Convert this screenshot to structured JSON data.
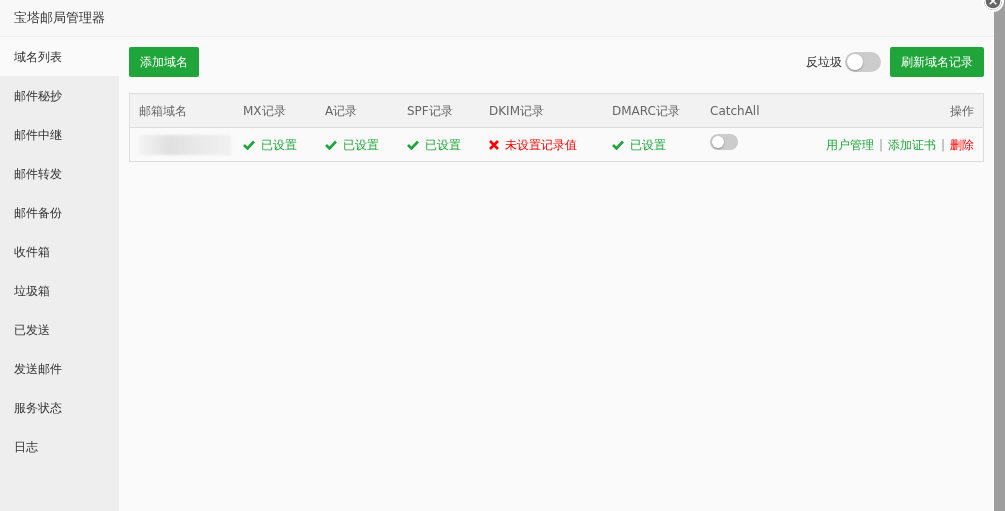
{
  "window": {
    "title": "宝塔邮局管理器"
  },
  "sidebar": {
    "items": [
      {
        "label": "域名列表",
        "selected": true
      },
      {
        "label": "邮件秘抄",
        "selected": false
      },
      {
        "label": "邮件中继",
        "selected": false
      },
      {
        "label": "邮件转发",
        "selected": false
      },
      {
        "label": "邮件备份",
        "selected": false
      },
      {
        "label": "收件箱",
        "selected": false
      },
      {
        "label": "垃圾箱",
        "selected": false
      },
      {
        "label": "已发送",
        "selected": false
      },
      {
        "label": "发送邮件",
        "selected": false
      },
      {
        "label": "服务状态",
        "selected": false
      },
      {
        "label": "日志",
        "selected": false
      }
    ]
  },
  "toolbar": {
    "add_button": "添加域名",
    "antispam_label": "反垃圾",
    "antispam_on": false,
    "refresh_button": "刷新域名记录"
  },
  "table": {
    "columns": [
      "邮箱域名",
      "MX记录",
      "A记录",
      "SPF记录",
      "DKIM记录",
      "DMARC记录",
      "CatchAll",
      "操作"
    ],
    "rows": [
      {
        "domain_blurred": true,
        "records": [
          {
            "ok": true,
            "text": "已设置"
          },
          {
            "ok": true,
            "text": "已设置"
          },
          {
            "ok": true,
            "text": "已设置"
          },
          {
            "ok": false,
            "text": "未设置记录值"
          },
          {
            "ok": true,
            "text": "已设置"
          }
        ],
        "catchall_on": false,
        "actions": [
          {
            "label": "用户管理",
            "kind": "link",
            "separator": "|"
          },
          {
            "label": "添加证书",
            "kind": "link",
            "separator": "|"
          },
          {
            "label": "删除",
            "kind": "danger"
          }
        ]
      }
    ]
  }
}
